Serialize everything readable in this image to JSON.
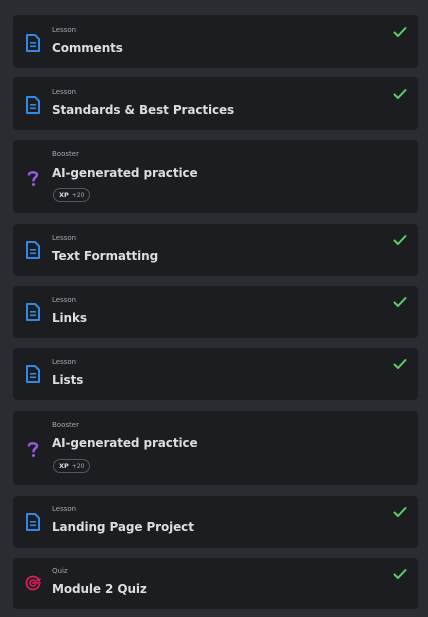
{
  "items": [
    {
      "type": "Lesson",
      "title": "Comments",
      "completed": true,
      "icon": "lesson-document-icon"
    },
    {
      "type": "Lesson",
      "title": "Standards & Best Practices",
      "completed": true,
      "icon": "lesson-document-icon"
    },
    {
      "type": "Booster",
      "title": "AI-generated practice",
      "completed": false,
      "icon": "question-mark-icon",
      "xp_label": "XP",
      "xp_value": "+20"
    },
    {
      "type": "Lesson",
      "title": "Text Formatting",
      "completed": true,
      "icon": "lesson-document-icon"
    },
    {
      "type": "Lesson",
      "title": "Links",
      "completed": true,
      "icon": "lesson-document-icon"
    },
    {
      "type": "Lesson",
      "title": "Lists",
      "completed": true,
      "icon": "lesson-document-icon"
    },
    {
      "type": "Booster",
      "title": "AI-generated practice",
      "completed": false,
      "icon": "question-mark-icon",
      "xp_label": "XP",
      "xp_value": "+20"
    },
    {
      "type": "Lesson",
      "title": "Landing Page Project",
      "completed": true,
      "icon": "lesson-document-icon"
    },
    {
      "type": "Quiz",
      "title": "Module 2 Quiz",
      "completed": true,
      "icon": "quiz-target-icon"
    }
  ],
  "colors": {
    "lesson_icon": "#2f8ae6",
    "booster_icon": "#9b59e6",
    "quiz_icon": "#e11d59",
    "check": "#5bd06a"
  }
}
